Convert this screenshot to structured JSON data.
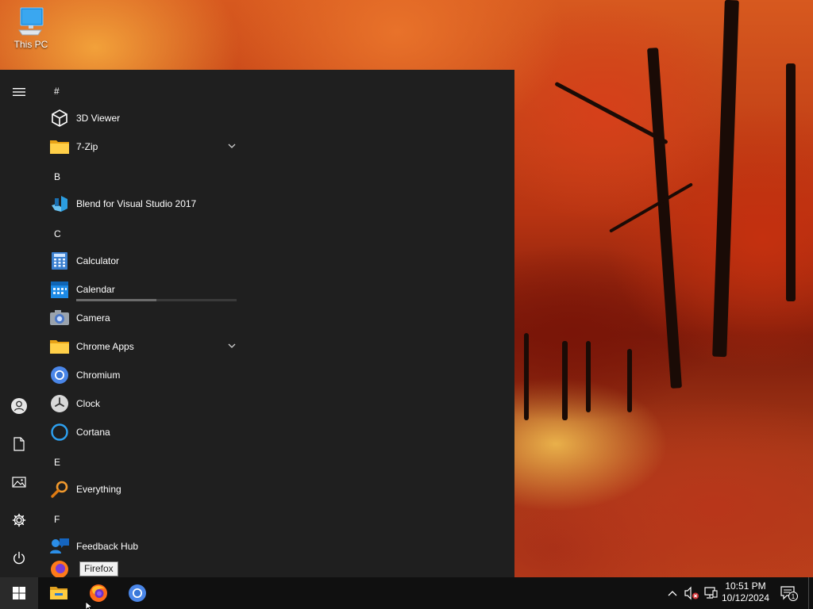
{
  "desktop": {
    "icons": [
      {
        "label": "This PC",
        "icon": "this-pc-icon"
      }
    ]
  },
  "start_menu": {
    "rail": {
      "menu": "hamburger-icon",
      "user": "user-icon",
      "documents": "document-icon",
      "pictures": "pictures-icon",
      "settings": "gear-icon",
      "power": "power-icon"
    },
    "groups": {
      "hash": "#",
      "b": "B",
      "c": "C",
      "e": "E",
      "f": "F"
    },
    "apps": {
      "viewer3d": "3D Viewer",
      "zip": "7-Zip",
      "blend": "Blend for Visual Studio 2017",
      "calculator": "Calculator",
      "calendar": "Calendar",
      "camera": "Camera",
      "chrome_apps": "Chrome Apps",
      "chromium": "Chromium",
      "clock": "Clock",
      "cortana": "Cortana",
      "everything": "Everything",
      "feedback": "Feedback Hub"
    },
    "calendar_progress": 0.5
  },
  "tooltip": {
    "text": "Firefox"
  },
  "taskbar": {
    "start": "windows-logo-icon",
    "pinned": [
      "file-explorer-icon",
      "firefox-icon",
      "chromium-icon"
    ],
    "tray": {
      "overflow": "chevron-up-icon",
      "volume": "volume-muted-icon",
      "network": "network-icon",
      "notifications_count": "1"
    },
    "clock": {
      "time": "10:51 PM",
      "date": "10/12/2024"
    }
  },
  "colors": {
    "menu_bg": "#1f1f1f",
    "taskbar_bg": "#101010",
    "accent_blue": "#0078d7"
  }
}
